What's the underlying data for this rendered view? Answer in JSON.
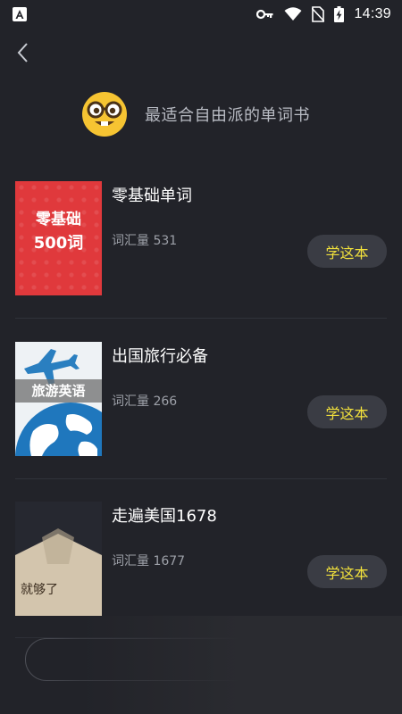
{
  "status_bar": {
    "time": "14:39",
    "icons": [
      "app-badge-icon",
      "key-icon",
      "wifi-icon",
      "no-sim-icon",
      "battery-charging-icon"
    ]
  },
  "nav": {
    "back_icon": "chevron-left-icon"
  },
  "header": {
    "emoji_icon": "nerd-face-emoji-icon",
    "title": "最适合自由派的单词书"
  },
  "books": [
    {
      "title": "零基础单词",
      "count": "词汇量 531",
      "button": "学这本",
      "cover": {
        "line1": "零基础",
        "line2": "500词",
        "color": "#e0393c"
      }
    },
    {
      "title": "出国旅行必备",
      "count": "词汇量 266",
      "button": "学这本",
      "cover": {
        "label": "旅游英语"
      }
    },
    {
      "title": "走遍美国1678",
      "count": "词汇量 1677",
      "button": "学这本",
      "cover": {
        "label": "就够了"
      }
    }
  ],
  "colors": {
    "background": "#222329",
    "accent": "#f2e13c",
    "button_bg": "#3a3c44",
    "muted_text": "#9da0a8"
  }
}
